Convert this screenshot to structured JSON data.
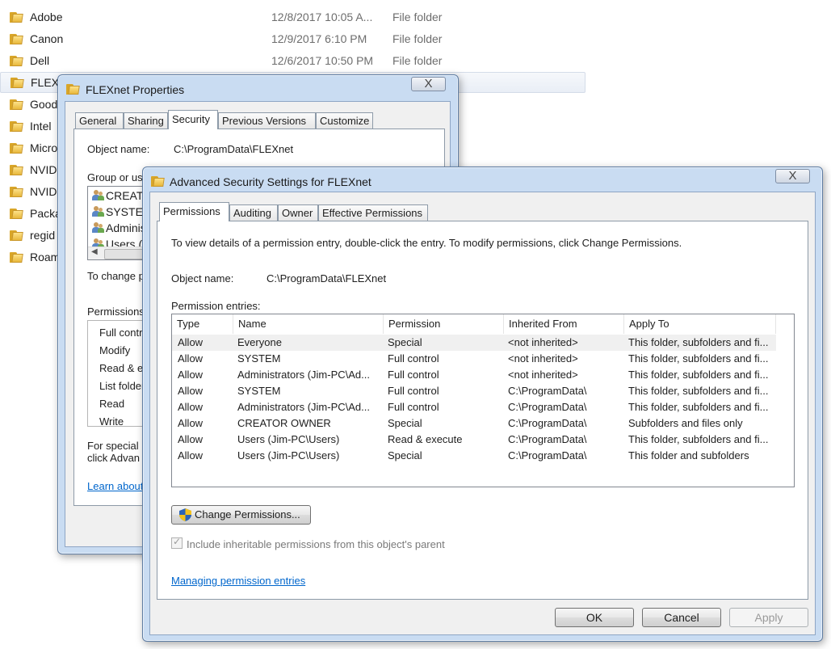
{
  "explorer": {
    "files": [
      {
        "name": "Adobe",
        "date": "12/8/2017 10:05 A...",
        "type": "File folder"
      },
      {
        "name": "Canon",
        "date": "12/9/2017 6:10 PM",
        "type": "File folder"
      },
      {
        "name": "Dell",
        "date": "12/6/2017 10:50 PM",
        "type": "File folder"
      },
      {
        "name": "FLEXnet",
        "date": "",
        "type": ""
      },
      {
        "name": "Good",
        "date": "",
        "type": ""
      },
      {
        "name": "Intel",
        "date": "",
        "type": ""
      },
      {
        "name": "Micro",
        "date": "",
        "type": ""
      },
      {
        "name": "NVID",
        "date": "",
        "type": ""
      },
      {
        "name": "NVID",
        "date": "",
        "type": ""
      },
      {
        "name": "Packa",
        "date": "",
        "type": ""
      },
      {
        "name": "regid",
        "date": "",
        "type": ""
      },
      {
        "name": "Roam",
        "date": "",
        "type": ""
      }
    ]
  },
  "properties": {
    "title": "FLEXnet Properties",
    "close": "X",
    "tabs": [
      "General",
      "Sharing",
      "Security",
      "Previous Versions",
      "Customize"
    ],
    "object_name_label": "Object name:",
    "object_name_value": "C:\\ProgramData\\FLEXnet",
    "group_label": "Group or us",
    "groups": [
      "CREAT",
      "SYSTE",
      "Adminis",
      "Users (J"
    ],
    "to_change": "To change p",
    "permissions_label": "Permissions",
    "permissions": [
      "Full contro",
      "Modify",
      "Read & e",
      "List folder",
      "Read",
      "Write"
    ],
    "special_1": "For special",
    "special_2": "click Advan",
    "learn_about": "Learn about"
  },
  "advanced": {
    "title": "Advanced Security Settings for FLEXnet",
    "close": "X",
    "tabs": [
      "Permissions",
      "Auditing",
      "Owner",
      "Effective Permissions"
    ],
    "instructions": "To view details of a permission entry, double-click the entry. To modify permissions, click Change Permissions.",
    "object_name_label": "Object name:",
    "object_name_value": "C:\\ProgramData\\FLEXnet",
    "entries_label": "Permission entries:",
    "columns": [
      "Type",
      "Name",
      "Permission",
      "Inherited From",
      "Apply To"
    ],
    "rows": [
      {
        "type": "Allow",
        "name": "Everyone",
        "permission": "Special",
        "inherited": "<not inherited>",
        "apply": "This folder, subfolders and fi..."
      },
      {
        "type": "Allow",
        "name": "SYSTEM",
        "permission": "Full control",
        "inherited": "<not inherited>",
        "apply": "This folder, subfolders and fi..."
      },
      {
        "type": "Allow",
        "name": "Administrators (Jim-PC\\Ad...",
        "permission": "Full control",
        "inherited": "<not inherited>",
        "apply": "This folder, subfolders and fi..."
      },
      {
        "type": "Allow",
        "name": "SYSTEM",
        "permission": "Full control",
        "inherited": "C:\\ProgramData\\",
        "apply": "This folder, subfolders and fi..."
      },
      {
        "type": "Allow",
        "name": "Administrators (Jim-PC\\Ad...",
        "permission": "Full control",
        "inherited": "C:\\ProgramData\\",
        "apply": "This folder, subfolders and fi..."
      },
      {
        "type": "Allow",
        "name": "CREATOR OWNER",
        "permission": "Special",
        "inherited": "C:\\ProgramData\\",
        "apply": "Subfolders and files only"
      },
      {
        "type": "Allow",
        "name": "Users (Jim-PC\\Users)",
        "permission": "Read & execute",
        "inherited": "C:\\ProgramData\\",
        "apply": "This folder, subfolders and fi..."
      },
      {
        "type": "Allow",
        "name": "Users (Jim-PC\\Users)",
        "permission": "Special",
        "inherited": "C:\\ProgramData\\",
        "apply": "This folder and subfolders"
      }
    ],
    "change_button": "Change Permissions...",
    "include_inheritable": "Include inheritable permissions from this object's parent",
    "include_checked": true,
    "managing_link": "Managing permission entries",
    "ok": "OK",
    "cancel": "Cancel",
    "apply": "Apply"
  }
}
